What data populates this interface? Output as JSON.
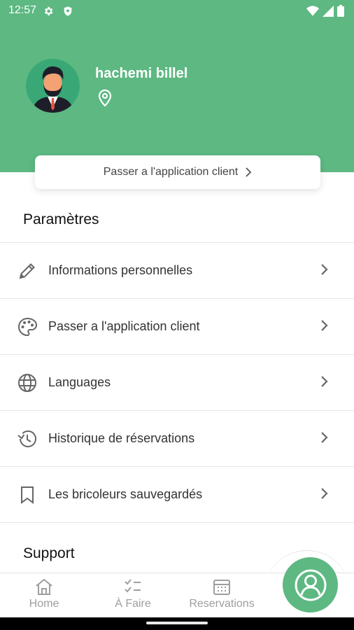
{
  "status": {
    "time": "12:57",
    "icons": [
      "gear-icon",
      "shield-icon",
      "wifi-icon",
      "signal-icon",
      "battery-icon"
    ]
  },
  "profile": {
    "name": "hachemi billel",
    "avatar_icon": "avatar-man-icon",
    "location_icon": "location-pin-icon"
  },
  "switch_card": {
    "label": "Passer a l'application client"
  },
  "sections": {
    "params_title": "Paramètres",
    "support_title": "Support"
  },
  "settings": [
    {
      "label": "Informations personnelles",
      "icon": "pencil-icon"
    },
    {
      "label": "Passer a l'application client",
      "icon": "palette-icon"
    },
    {
      "label": "Languages",
      "icon": "globe-icon"
    },
    {
      "label": "Historique de réservations",
      "icon": "history-icon"
    },
    {
      "label": "Les bricoleurs sauvegardés",
      "icon": "bookmark-icon"
    }
  ],
  "nav": {
    "home": "Home",
    "todo": "À Faire",
    "reservations": "Reservations",
    "fab_icon": "profile-icon"
  },
  "colors": {
    "brand": "#5db882",
    "nav_inactive": "#9e9e9e",
    "text": "#333333"
  }
}
